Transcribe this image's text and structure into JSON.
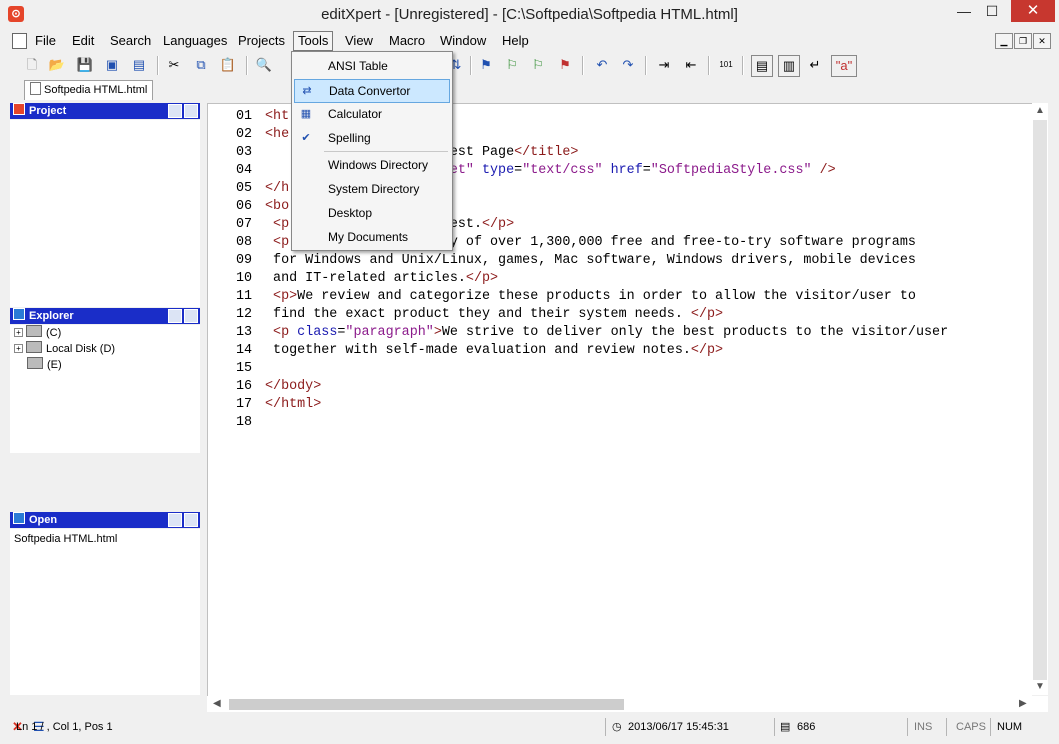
{
  "window": {
    "title": "editXpert - [Unregistered] - [C:\\Softpedia\\Softpedia HTML.html]",
    "minimize_glyph": "—",
    "maximize_glyph": "☐",
    "close_glyph": "✕"
  },
  "menu": {
    "items": [
      "File",
      "Edit",
      "Search",
      "Languages",
      "Projects",
      "Tools",
      "View",
      "Macro",
      "Window",
      "Help"
    ],
    "active": "Tools"
  },
  "tools_menu": {
    "items": [
      {
        "label": "ANSI Table",
        "icon": "none"
      },
      {
        "label": "Data Convertor",
        "icon": "data-convertor-icon",
        "highlighted": true
      },
      {
        "label": "Calculator",
        "icon": "calculator-icon"
      },
      {
        "label": "Spelling",
        "icon": "spelling-check-icon"
      },
      {
        "label": "Windows Directory",
        "icon": "none"
      },
      {
        "label": "System Directory",
        "icon": "none"
      },
      {
        "label": "Desktop",
        "icon": "none"
      },
      {
        "label": "My Documents",
        "icon": "none"
      }
    ]
  },
  "tab": {
    "label": "Softpedia HTML.html"
  },
  "panels": {
    "project": {
      "title": "Project"
    },
    "explorer": {
      "title": "Explorer",
      "drives": [
        {
          "label": "(C)",
          "expand": "+"
        },
        {
          "label": "Local Disk (D)",
          "expand": "+"
        },
        {
          "label": "(E)",
          "expand": ""
        }
      ]
    },
    "open": {
      "title": "Open",
      "files": [
        "Softpedia HTML.html"
      ]
    }
  },
  "editor": {
    "lines": [
      {
        "n": "01",
        "html": "<span class='tag'>&lt;ht</span>"
      },
      {
        "n": "02",
        "html": "<span class='tag'>&lt;he</span>"
      },
      {
        "n": "03",
        "html": "                      Test Page<span class='tag'>&lt;/title&gt;</span>"
      },
      {
        "n": "04",
        "html": "                     <span class='str'>heet\"</span> <span class='attr'>type</span>=<span class='str'>\"text/css\"</span> <span class='attr'>href</span>=<span class='str'>\"SoftpediaStyle.css\"</span> <span class='tag'>/&gt;</span>"
      },
      {
        "n": "05",
        "html": "<span class='tag'>&lt;/h</span>"
      },
      {
        "n": "06",
        "html": "<span class='tag'>&lt;bo</span>"
      },
      {
        "n": "07",
        "html": " <span class='tag'>&lt;p</span>                ia test.<span class='tag'>&lt;/p&gt;</span>"
      },
      {
        "n": "08",
        "html": " <span class='tag'>&lt;p</span>                brary of over 1,300,000 free and free-to-try software programs"
      },
      {
        "n": "09",
        "html": " for Windows and Unix/Linux, games, Mac software, Windows drivers, mobile devices"
      },
      {
        "n": "10",
        "html": " and IT-related articles.<span class='tag'>&lt;/p&gt;</span>"
      },
      {
        "n": "11",
        "html": " <span class='tag'>&lt;p&gt;</span>We review and categorize these products in order to allow the visitor/user to"
      },
      {
        "n": "12",
        "html": " find the exact product they and their system needs. <span class='tag'>&lt;/p&gt;</span>"
      },
      {
        "n": "13",
        "html": " <span class='tag'>&lt;p</span> <span class='attr'>class</span>=<span class='str'>\"paragraph\"</span><span class='tag'>&gt;</span>We strive to deliver only the best products to the visitor/user"
      },
      {
        "n": "14",
        "html": " together with self-made evaluation and review notes.<span class='tag'>&lt;/p&gt;</span>"
      },
      {
        "n": "15",
        "html": ""
      },
      {
        "n": "16",
        "html": "<span class='tag'>&lt;/body&gt;</span>"
      },
      {
        "n": "17",
        "html": "<span class='tag'>&lt;/html&gt;</span>"
      },
      {
        "n": "18",
        "html": ""
      }
    ]
  },
  "status": {
    "position": "Ln 1 / , Col 1, Pos 1",
    "datetime": "2013/06/17 15:45:31",
    "size": "686",
    "ins": "INS",
    "caps": "CAPS",
    "num": "NUM"
  },
  "colors": {
    "panel_header": "#1a2dc8",
    "menu_highlight": "#cce8ff",
    "close_button": "#c7372f"
  }
}
